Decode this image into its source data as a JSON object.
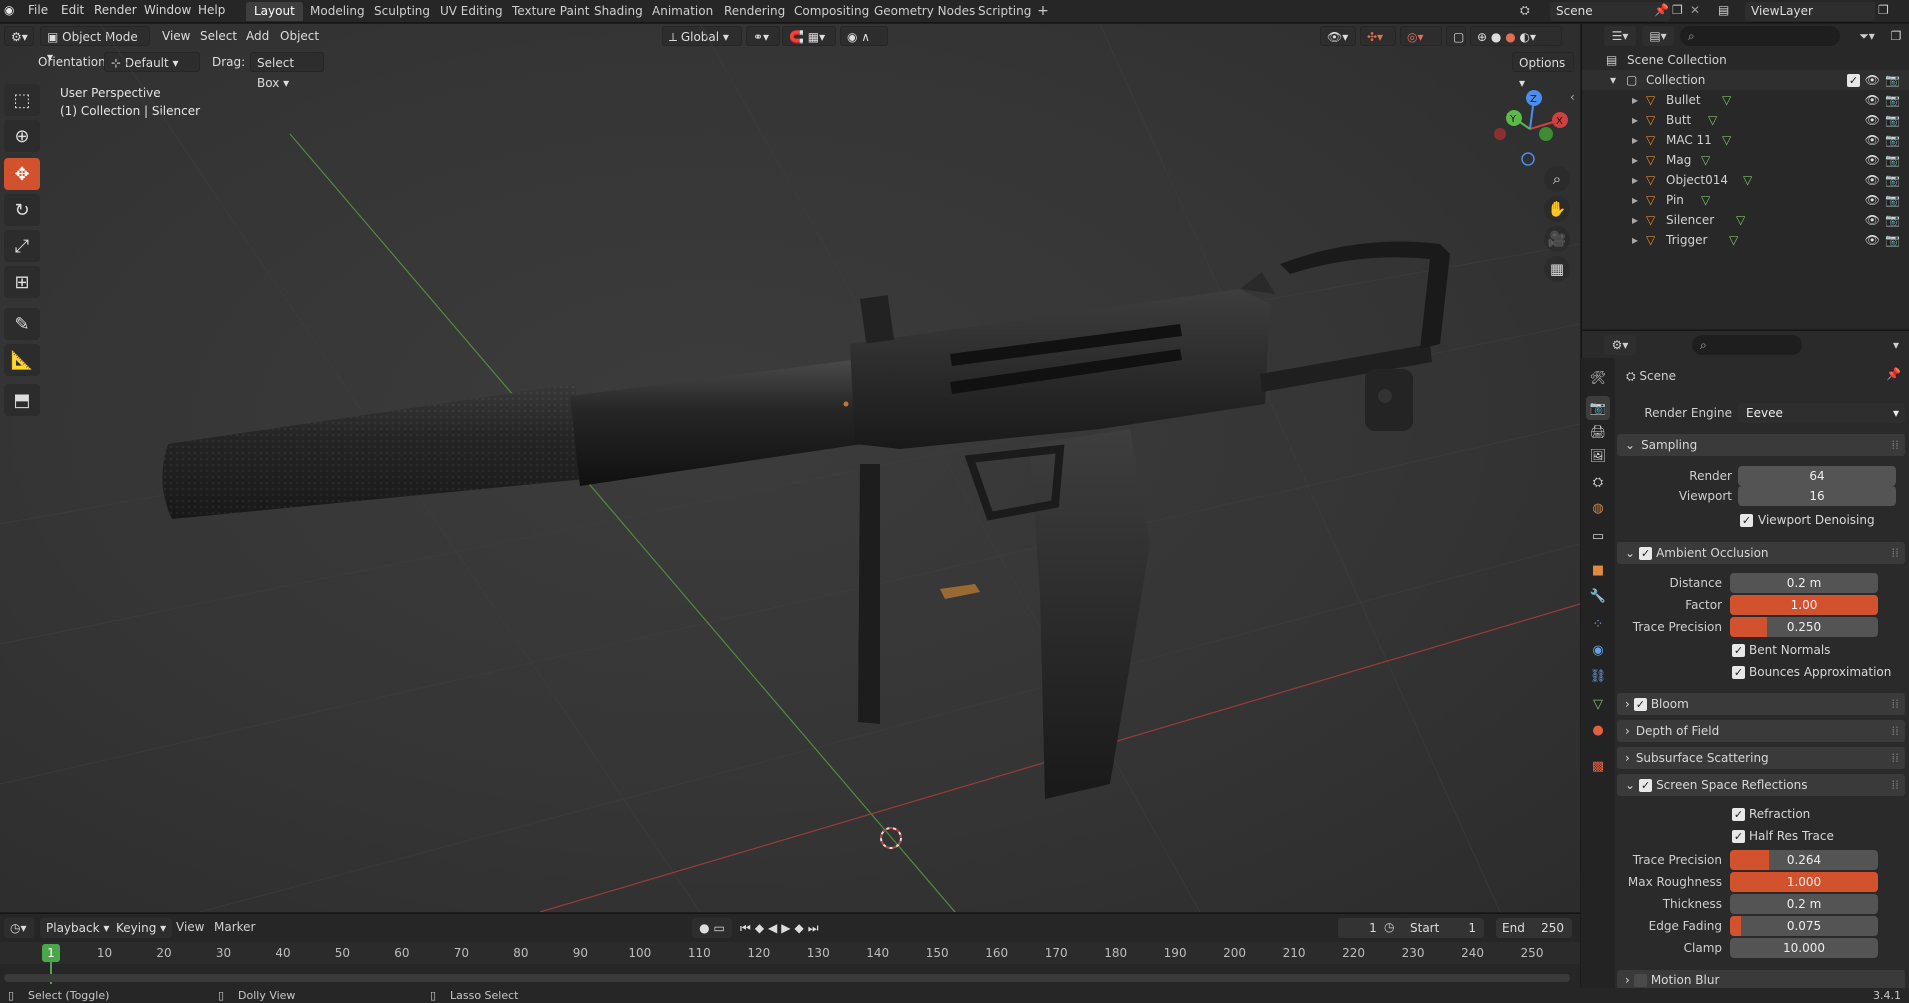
{
  "menu": {
    "items": [
      "File",
      "Edit",
      "Render",
      "Window",
      "Help"
    ]
  },
  "workspaces": {
    "tabs": [
      "Layout",
      "Modeling",
      "Sculpting",
      "UV Editing",
      "Texture Paint",
      "Shading",
      "Animation",
      "Rendering",
      "Compositing",
      "Geometry Nodes",
      "Scripting"
    ],
    "active": "Layout"
  },
  "top_right": {
    "scene": "Scene",
    "view_layer": "ViewLayer"
  },
  "viewport_header": {
    "mode": "Object Mode",
    "menus": [
      "View",
      "Select",
      "Add",
      "Object"
    ],
    "transform": "Global",
    "orientation_label": "Orientation:",
    "orientation_value": "Default",
    "drag_label": "Drag:",
    "drag_value": "Select Box",
    "options": "Options"
  },
  "viewport_overlay": {
    "line1": "User Perspective",
    "line2": "(1) Collection | Silencer"
  },
  "gizmo": {
    "x": "X",
    "y": "Y",
    "z": "Z"
  },
  "outliner": {
    "root": "Scene Collection",
    "collection": "Collection",
    "items": [
      "Bullet",
      "Butt",
      "MAC 11",
      "Mag",
      "Object014",
      "Pin",
      "Silencer",
      "Trigger"
    ]
  },
  "properties": {
    "context": "Scene",
    "render_engine_label": "Render Engine",
    "render_engine": "Eevee",
    "sampling": {
      "title": "Sampling",
      "render_label": "Render",
      "render": "64",
      "viewport_label": "Viewport",
      "viewport": "16",
      "denoise": "Viewport Denoising"
    },
    "ao": {
      "title": "Ambient Occlusion",
      "distance_label": "Distance",
      "distance": "0.2 m",
      "factor_label": "Factor",
      "factor": "1.00",
      "factor_fill": 1.0,
      "trace_label": "Trace Precision",
      "trace": "0.250",
      "trace_fill": 0.25,
      "bent": "Bent Normals",
      "bounces": "Bounces Approximation"
    },
    "collapsed": [
      "Bloom",
      "Depth of Field",
      "Subsurface Scattering"
    ],
    "ssr": {
      "title": "Screen Space Reflections",
      "refraction": "Refraction",
      "half_res": "Half Res Trace",
      "trace_label": "Trace Precision",
      "trace": "0.264",
      "trace_fill": 0.264,
      "roughness_label": "Max Roughness",
      "roughness": "1.000",
      "roughness_fill": 1.0,
      "thickness_label": "Thickness",
      "thickness": "0.2 m",
      "edge_label": "Edge Fading",
      "edge": "0.075",
      "edge_fill": 0.075,
      "clamp_label": "Clamp",
      "clamp": "10.000"
    },
    "motion_blur": "Motion Blur"
  },
  "timeline": {
    "menus": [
      "Playback",
      "Keying",
      "View",
      "Marker"
    ],
    "current_frame": "1",
    "start_label": "Start",
    "start": "1",
    "end_label": "End",
    "end": "250",
    "ticks": [
      "1",
      "10",
      "20",
      "30",
      "40",
      "50",
      "60",
      "70",
      "80",
      "90",
      "100",
      "110",
      "120",
      "130",
      "140",
      "150",
      "160",
      "170",
      "180",
      "190",
      "200",
      "210",
      "220",
      "230",
      "240",
      "250"
    ]
  },
  "status": {
    "select": "Select (Toggle)",
    "dolly": "Dolly View",
    "lasso": "Lasso Select",
    "version": "3.4.1"
  },
  "colors": {
    "accent": "#d2522d",
    "bg": "#353535"
  }
}
